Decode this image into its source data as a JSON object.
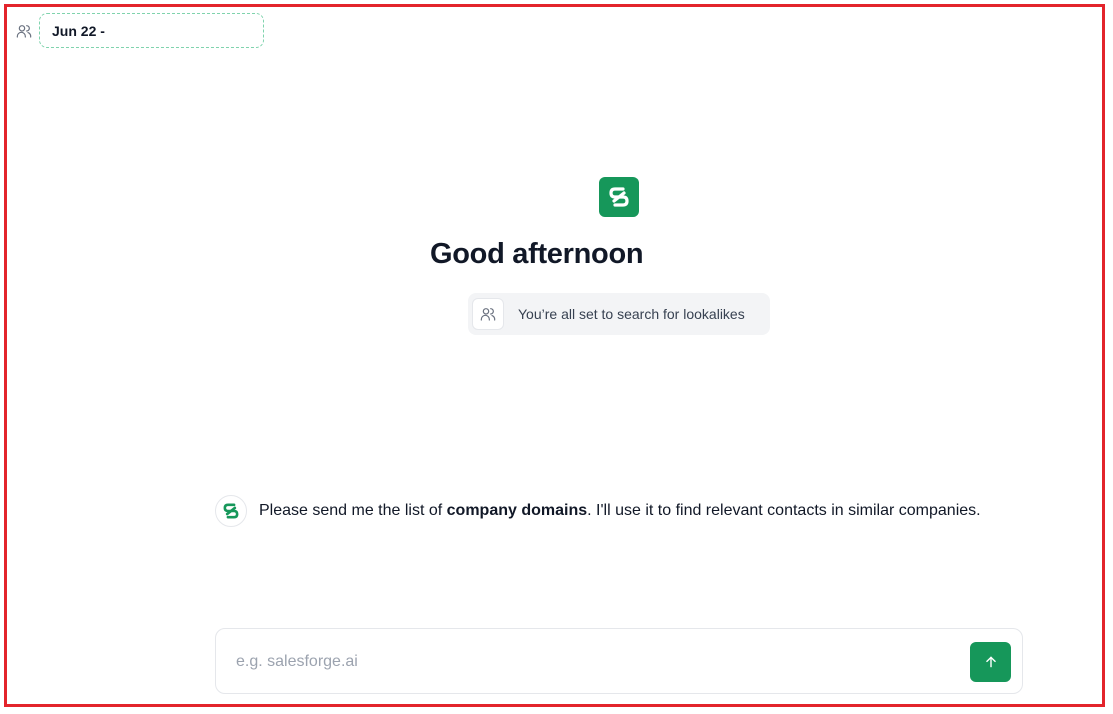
{
  "colors": {
    "brand_green": "#16975a",
    "frame_red": "#e3242b",
    "pill_bg": "#f3f4f6"
  },
  "topbar": {
    "icon": "users-icon",
    "date_range": "Jun 22 -"
  },
  "hero": {
    "logo_icon": "brand-logo-icon",
    "greeting": "Good afternoon",
    "status_icon": "users-icon",
    "status_text": "You’re all set to search for lookalikes"
  },
  "chat": {
    "avatar_icon": "brand-logo-icon",
    "message_before": "Please send me the list of ",
    "message_bold": "company domains",
    "message_after": ". I'll use it to find relevant contacts in similar companies."
  },
  "composer": {
    "placeholder": "e.g. salesforge.ai",
    "value": "",
    "send_icon": "arrow-up-icon"
  }
}
